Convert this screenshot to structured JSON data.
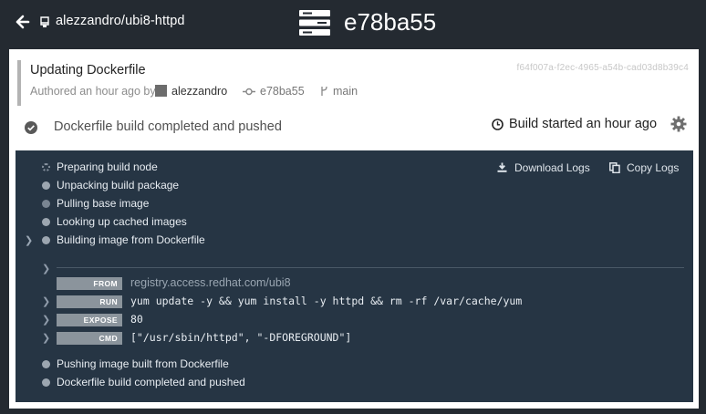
{
  "header": {
    "repo": "alezzandro/ubi8-httpd",
    "build_id": "e78ba55"
  },
  "commit": {
    "title": "Updating Dockerfile",
    "full_hash": "f64f007a-f2ec-4965-a54b-cad03d8b39c4",
    "authored_prefix": "Authored an hour ago by",
    "author": "alezzandro",
    "short_sha": "e78ba55",
    "branch": "main"
  },
  "status": {
    "text": "Dockerfile build completed and pushed",
    "started": "Build started an hour ago"
  },
  "log_actions": {
    "download": "Download Logs",
    "copy": "Copy Logs"
  },
  "steps": [
    {
      "name": "Preparing build node"
    },
    {
      "name": "Unpacking build package"
    },
    {
      "name": "Pulling base image"
    },
    {
      "name": "Looking up cached images"
    },
    {
      "name": "Building image from Dockerfile"
    },
    {
      "name": "Pushing image built from Dockerfile"
    },
    {
      "name": "Dockerfile build completed and pushed"
    }
  ],
  "commands": [
    {
      "badge": "FROM",
      "text": "registry.access.redhat.com/ubi8"
    },
    {
      "badge": "RUN",
      "text": "yum update -y && yum install -y httpd && rm -rf /var/cache/yum"
    },
    {
      "badge": "EXPOSE",
      "text": "80"
    },
    {
      "badge": "CMD",
      "text": "[\"/usr/sbin/httpd\", \"-DFOREGROUND\"]"
    }
  ]
}
